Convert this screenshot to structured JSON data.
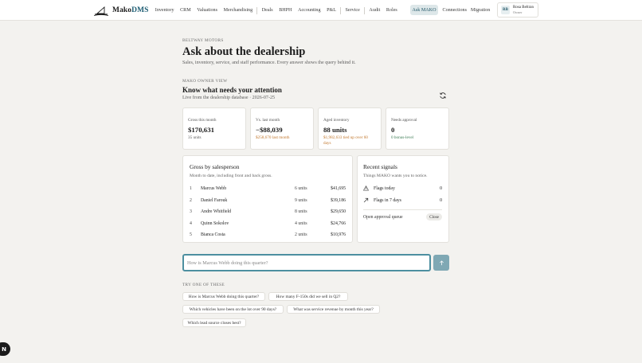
{
  "brand": {
    "name_prefix": "Mako",
    "name_suffix": "DMS"
  },
  "nav": {
    "items": [
      "Inventory",
      "CRM",
      "Valuations",
      "Merchandising",
      "Deals",
      "BHPH",
      "Accounting",
      "P&L",
      "Service",
      "Audit",
      "Roles"
    ],
    "ask_label": "Ask MAKO",
    "right_items": [
      "Connections",
      "Migration"
    ]
  },
  "user": {
    "initials": "RB",
    "name": "Rosa Beltran",
    "role": "Owner"
  },
  "header": {
    "kicker": "BELTWAY MOTORS",
    "title": "Ask about the dealership",
    "subtitle": "Sales, inventory, service, and staff performance. Every answer shows the query behind it."
  },
  "owner_view": {
    "kicker": "MAKO OWNER VIEW",
    "title": "Know what needs your attention",
    "live_text": "Live from the dealership database · 2026-07-25",
    "refresh_icon": "refresh-icon"
  },
  "cards": [
    {
      "label": "Gross this month",
      "value": "$170,631",
      "note": "35 units",
      "note_color": "#5b5b5b"
    },
    {
      "label": "Vs. last month",
      "value": "−$88,039",
      "note": "$258,670 last month",
      "note_color": "#c2782e"
    },
    {
      "label": "Aged inventory",
      "value": "88 units",
      "note": "$1,982,633 tied up over 60 days",
      "note_color": "#c2782e"
    },
    {
      "label": "Needs approval",
      "value": "0",
      "note": "0 bonus-level",
      "note_color": "#3d7d55"
    }
  ],
  "salesperson": {
    "title": "Gross by salesperson",
    "subtitle": "Month to date, including front and back gross.",
    "rows": [
      {
        "rank": "1",
        "name": "Marcus Webb",
        "units": "6 units",
        "gross": "$41,695"
      },
      {
        "rank": "2",
        "name": "Daniel Farouk",
        "units": "9 units",
        "gross": "$39,186"
      },
      {
        "rank": "3",
        "name": "Andre Whitfield",
        "units": "8 units",
        "gross": "$29,650"
      },
      {
        "rank": "4",
        "name": "Quinn Sokolov",
        "units": "4 units",
        "gross": "$24,766"
      },
      {
        "rank": "5",
        "name": "Bianca Costa",
        "units": "2 units",
        "gross": "$10,976"
      }
    ]
  },
  "signals": {
    "title": "Recent signals",
    "subtitle": "Things MAKO wants you to notice.",
    "rows": [
      {
        "icon": "warning-icon",
        "label": "Flags today",
        "value": "0"
      },
      {
        "icon": "arrow-up-right-icon",
        "label": "Flags in 7 days",
        "value": "0"
      }
    ],
    "approval_label": "Open approval queue",
    "close_label": "Close"
  },
  "query": {
    "placeholder": "How is Marcus Webb doing this quarter?",
    "send_icon": "arrow-up-icon"
  },
  "suggestions": {
    "kicker": "TRY ONE OF THESE",
    "chips": [
      "How is Marcus Webb doing this quarter?",
      "How many F-150s did we sell in Q2?",
      "Which vehicles have been on the lot over 90 days?",
      "What was service revenue by month this year?",
      "Which lead source closes best?"
    ]
  },
  "badge": {
    "label": "N"
  },
  "colors": {
    "accent": "#4d8fa0",
    "brand": "#1e5e74",
    "warning": "#c2782e",
    "success": "#3d7d55"
  }
}
